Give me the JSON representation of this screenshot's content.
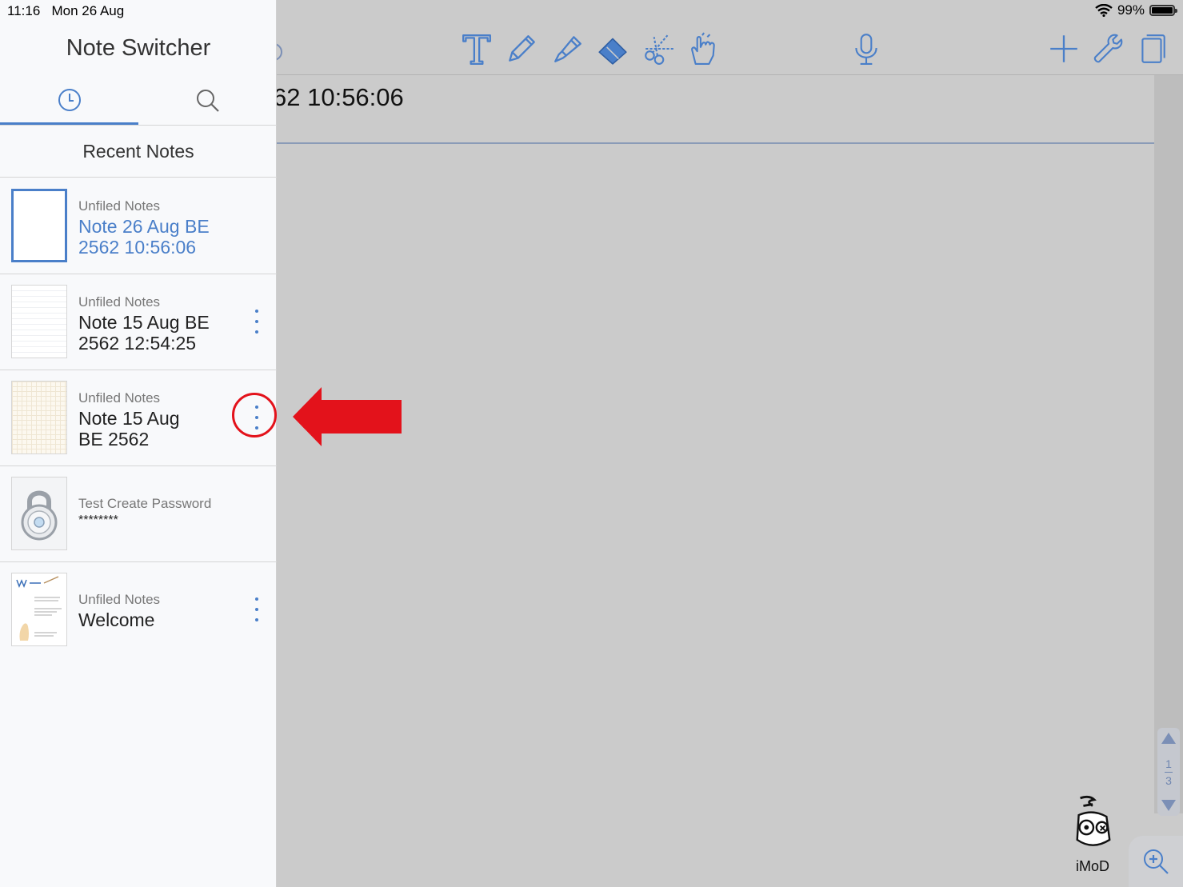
{
  "status_bar": {
    "time": "11:16",
    "date": "Mon 26 Aug",
    "battery": "99%"
  },
  "sidebar": {
    "title": "Note Switcher",
    "tabs": [
      {
        "name": "recent",
        "icon": "clock-icon",
        "active": true
      },
      {
        "name": "search",
        "icon": "search-icon",
        "active": false
      }
    ],
    "section_title": "Recent Notes",
    "notes": [
      {
        "folder": "Unfiled Notes",
        "title": "Note 26 Aug BE 2562 10:56:06",
        "selected": true,
        "thumb": "blank"
      },
      {
        "folder": "Unfiled Notes",
        "title": "Note 15 Aug BE 2562 12:54:25",
        "selected": false,
        "thumb": "lined"
      },
      {
        "folder": "Unfiled Notes",
        "title": "Note 15 Aug BE 2562",
        "selected": false,
        "thumb": "grid"
      },
      {
        "folder": "Test Create Password",
        "title": "********",
        "selected": false,
        "thumb": "lock"
      },
      {
        "folder": "Unfiled Notes",
        "title": "Welcome",
        "selected": false,
        "thumb": "welcome"
      }
    ]
  },
  "editor": {
    "note_title_partial": "62 10:56:06",
    "toolbar_icons": [
      "text-tool-icon",
      "pencil-icon",
      "highlighter-icon",
      "eraser-icon",
      "scissors-icon",
      "pointer-hand-icon",
      "microphone-icon",
      "add-icon",
      "wrench-icon",
      "pages-icon"
    ],
    "page_indicator": {
      "current": "1",
      "total": "3"
    },
    "accent_color": "#4a7fc9"
  },
  "watermark": {
    "text": "iMoD"
  },
  "annotation": {
    "color": "#e3121b"
  }
}
